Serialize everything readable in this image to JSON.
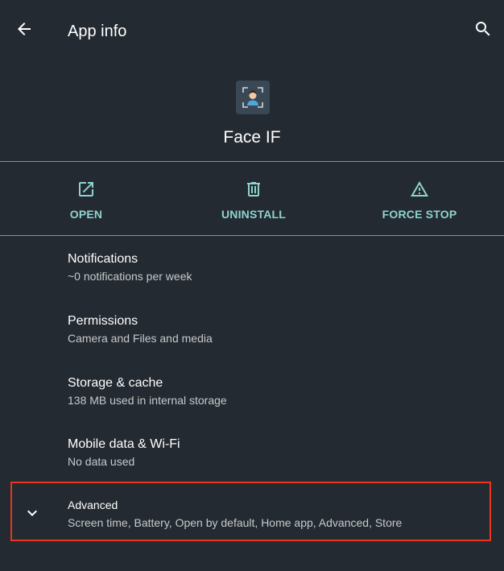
{
  "appbar": {
    "title": "App info",
    "back_icon": "arrow-back-icon",
    "search_icon": "search-icon"
  },
  "app": {
    "name": "Face IF",
    "icon": "face-scan-app-icon"
  },
  "actions": [
    {
      "label": "OPEN",
      "icon": "open-external-icon"
    },
    {
      "label": "UNINSTALL",
      "icon": "trash-icon"
    },
    {
      "label": "FORCE STOP",
      "icon": "warning-icon"
    }
  ],
  "items": [
    {
      "title": "Notifications",
      "summary": "~0 notifications per week"
    },
    {
      "title": "Permissions",
      "summary": "Camera and Files and media"
    },
    {
      "title": "Storage & cache",
      "summary": "138 MB used in internal storage"
    },
    {
      "title": "Mobile data & Wi-Fi",
      "summary": "No data used"
    }
  ],
  "advanced": {
    "title": "Advanced",
    "summary": "Screen time, Battery, Open by default, Home app, Advanced, Store",
    "icon": "chevron-down-icon"
  },
  "colors": {
    "background": "#242a31",
    "accent": "#8fd3cf",
    "highlight_border": "#e8361f"
  }
}
